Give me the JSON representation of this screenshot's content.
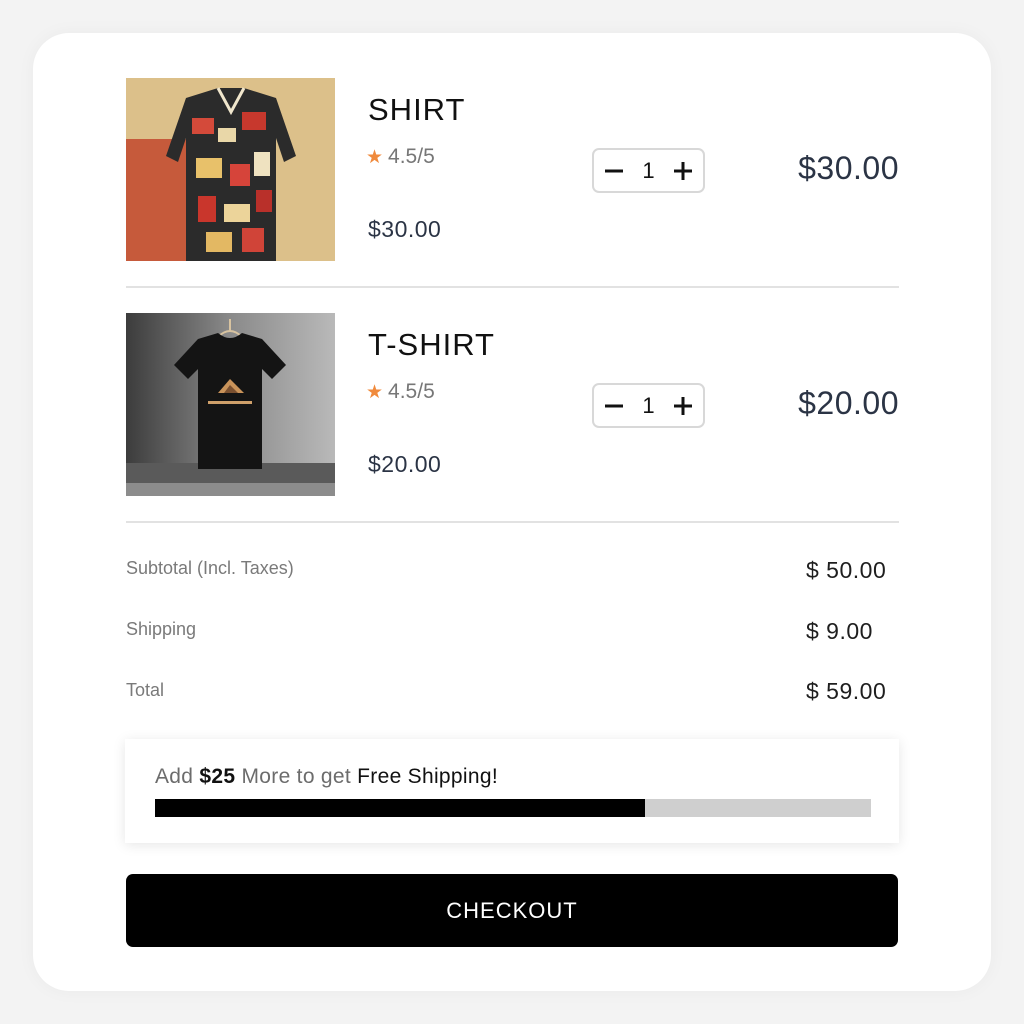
{
  "cart": {
    "items": [
      {
        "name": "SHIRT",
        "rating": "4.5/5",
        "unit_price": "$30.00",
        "quantity": "1",
        "line_total": "$30.00",
        "image_icon": "patterned-shirt-photo"
      },
      {
        "name": "T-SHIRT",
        "rating": "4.5/5",
        "unit_price": "$20.00",
        "quantity": "1",
        "line_total": "$20.00",
        "image_icon": "black-tshirt-photo"
      }
    ],
    "icons": {
      "star": "star-icon",
      "minus": "minus-icon",
      "plus": "plus-icon"
    }
  },
  "summary": {
    "subtotal_label": "Subtotal (Incl. Taxes)",
    "subtotal_value": "$ 50.00",
    "shipping_label": "Shipping",
    "shipping_value": "$ 9.00",
    "total_label": "Total",
    "total_value": "$ 59.00"
  },
  "shipping_promo": {
    "prefix": "Add",
    "amount": "$25",
    "middle": "More to get",
    "suffix": "Free Shipping!",
    "progress_fraction": 0.684
  },
  "checkout": {
    "label": "CHECKOUT"
  },
  "colors": {
    "accent_star": "#f08a3c",
    "progress_fill": "#000000",
    "progress_track": "#cfcfcf",
    "checkout_bg": "#000000"
  }
}
